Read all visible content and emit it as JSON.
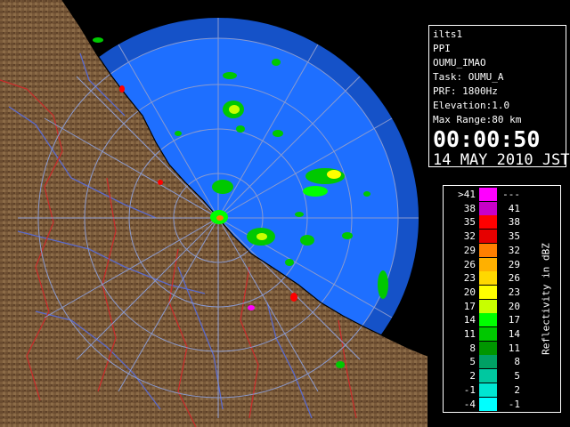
{
  "info": {
    "radar_id": "ilts1",
    "scan_type": "PPI",
    "site": "OUMU_IMAO",
    "task": "Task: OUMU_A",
    "prf": "PRF: 1800Hz",
    "elevation": "Elevation:1.0",
    "max_range": "Max Range:80 km",
    "time": "00:00:50",
    "date": "14 MAY 2010 JST"
  },
  "legend": {
    "unit": "Reflectivity in dBZ",
    "rows": [
      {
        "lo": ">41",
        "hi": "---",
        "color": "#ff00ff"
      },
      {
        "lo": "38",
        "hi": "41",
        "color": "#c800c8"
      },
      {
        "lo": "35",
        "hi": "38",
        "color": "#ff0000"
      },
      {
        "lo": "32",
        "hi": "35",
        "color": "#e60000"
      },
      {
        "lo": "29",
        "hi": "32",
        "color": "#ff7f00"
      },
      {
        "lo": "26",
        "hi": "29",
        "color": "#ffb000"
      },
      {
        "lo": "23",
        "hi": "26",
        "color": "#ffd800"
      },
      {
        "lo": "20",
        "hi": "23",
        "color": "#ffff00"
      },
      {
        "lo": "17",
        "hi": "20",
        "color": "#c8ff00"
      },
      {
        "lo": "14",
        "hi": "17",
        "color": "#00ff00"
      },
      {
        "lo": "11",
        "hi": "14",
        "color": "#00c800"
      },
      {
        "lo": "8",
        "hi": "11",
        "color": "#009600"
      },
      {
        "lo": "5",
        "hi": "8",
        "color": "#00a064"
      },
      {
        "lo": "2",
        "hi": "5",
        "color": "#00c8a0"
      },
      {
        "lo": "-1",
        "hi": "2",
        "color": "#00e6d2"
      },
      {
        "lo": "-4",
        "hi": "-1",
        "color": "#00ffff"
      }
    ]
  },
  "colors": {
    "sea": "#1e6fff",
    "outer_band": "#1552c8",
    "land": "#7a5a3a",
    "range_ring": "#8a9acf",
    "river": "#5a6acc",
    "boundary": "#cc2a2a"
  }
}
